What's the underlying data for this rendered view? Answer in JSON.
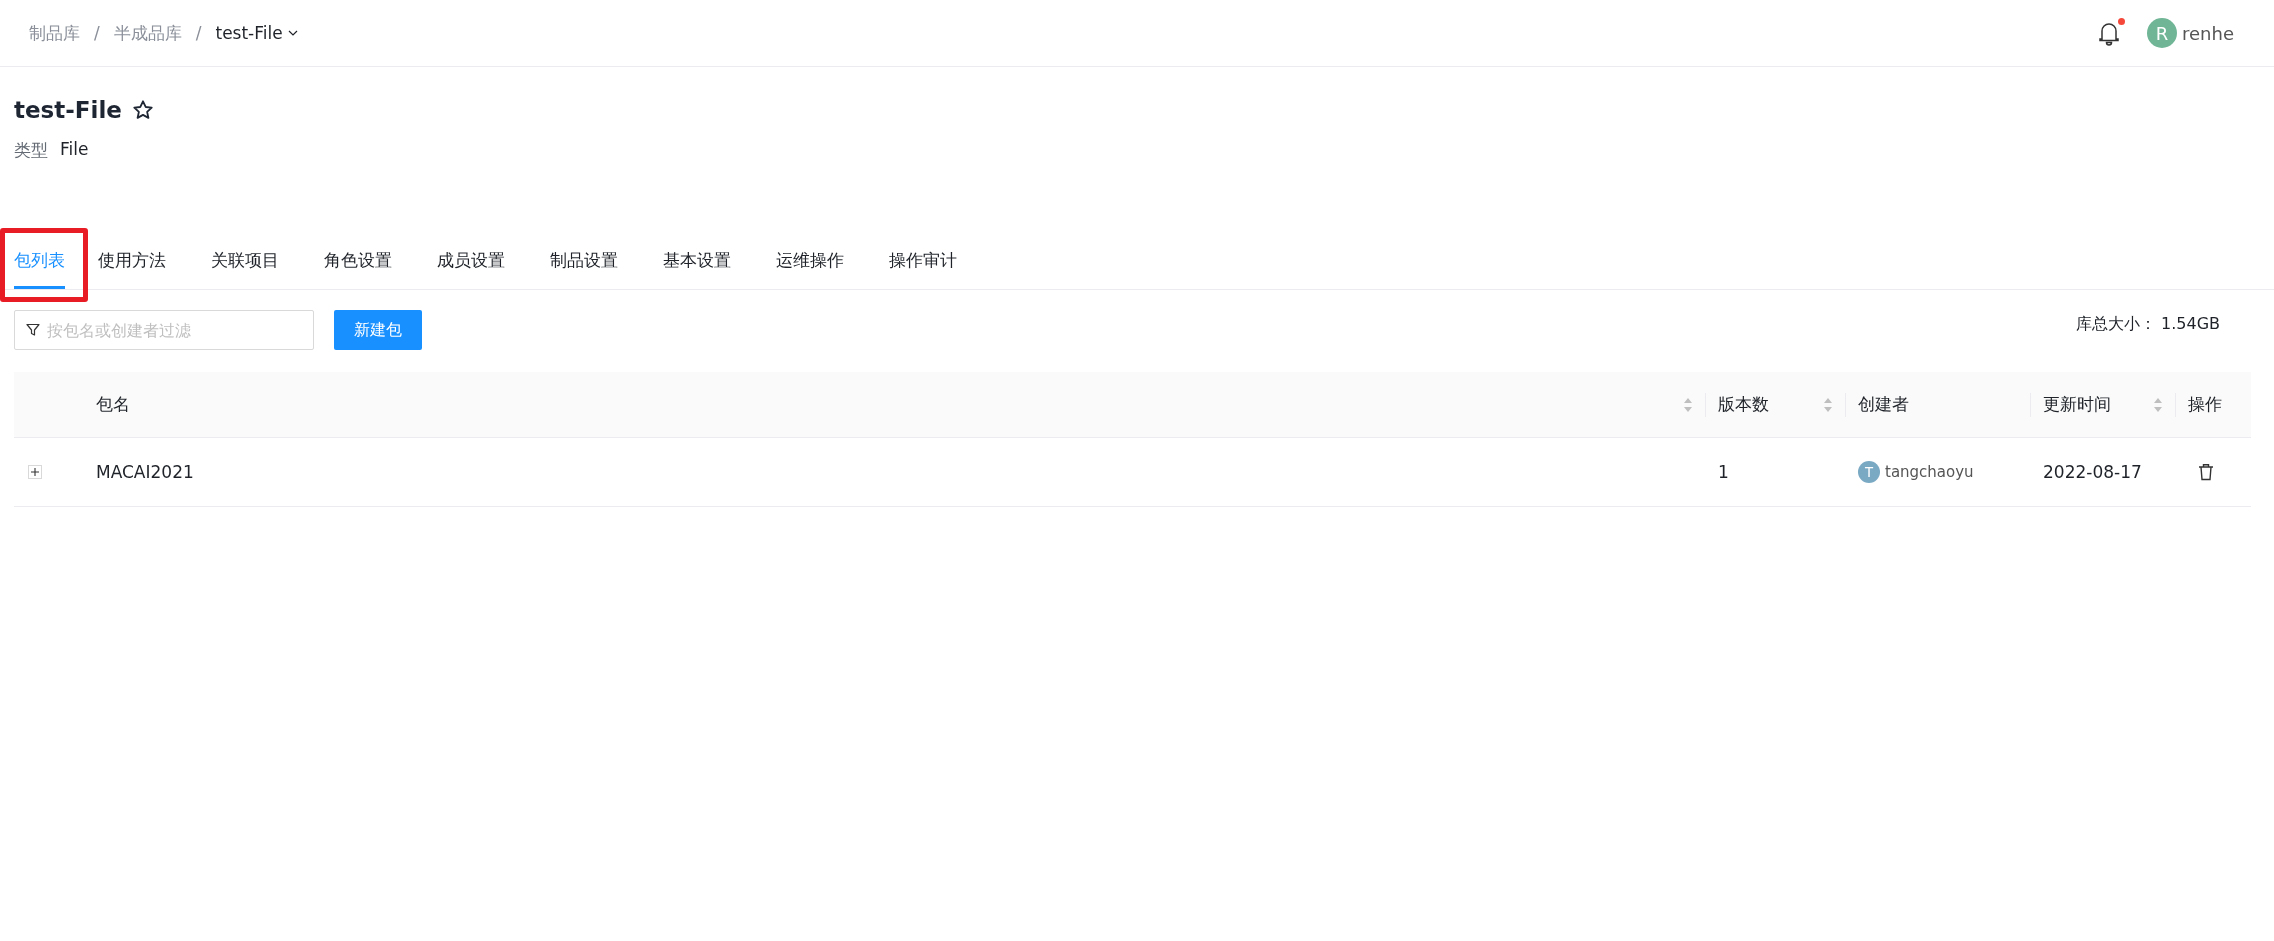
{
  "breadcrumb": [
    {
      "label": "制品库",
      "current": false,
      "separator": "/"
    },
    {
      "label": "半成品库",
      "current": false,
      "separator": "/"
    },
    {
      "label": "test-File",
      "current": true
    }
  ],
  "user": {
    "avatar_letter": "R",
    "name": "renhe",
    "has_unread": true
  },
  "header": {
    "title": "test-File",
    "starred": false,
    "type_label": "类型",
    "type_value": "File"
  },
  "tabs": [
    {
      "label": "包列表",
      "selected": true,
      "highlighted": true
    },
    {
      "label": "使用方法",
      "selected": false,
      "highlighted": false
    },
    {
      "label": "关联项目",
      "selected": false,
      "highlighted": false
    },
    {
      "label": "角色设置",
      "selected": false,
      "highlighted": false
    },
    {
      "label": "成员设置",
      "selected": false,
      "highlighted": false
    },
    {
      "label": "制品设置",
      "selected": false,
      "highlighted": false
    },
    {
      "label": "基本设置",
      "selected": false,
      "highlighted": false
    },
    {
      "label": "运维操作",
      "selected": false,
      "highlighted": false
    },
    {
      "label": "操作审计",
      "selected": false,
      "highlighted": false
    }
  ],
  "toolbar": {
    "filter_placeholder": "按包名或创建者过滤",
    "new_button": "新建包",
    "size_label": "库总大小：",
    "size_value": "1.54GB"
  },
  "table": {
    "columns": [
      {
        "label": "包名",
        "sortable": true
      },
      {
        "label": "版本数",
        "sortable": true
      },
      {
        "label": "创建者",
        "sortable": false
      },
      {
        "label": "更新时间",
        "sortable": true
      },
      {
        "label": "操作",
        "sortable": false
      }
    ],
    "rows": [
      {
        "expanded": false,
        "name": "MACAI2021",
        "versions": "1",
        "creator_letter": "T",
        "creator": "tangchaoyu",
        "updated": "2022-08-17"
      }
    ]
  }
}
